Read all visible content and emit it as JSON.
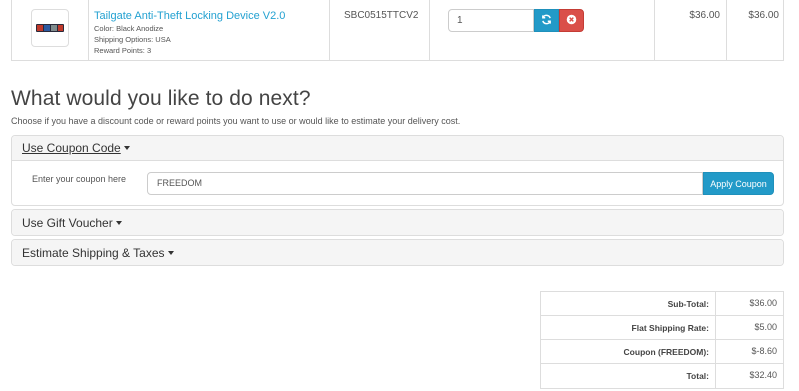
{
  "cart": {
    "product_name": "Tailgate Anti-Theft Locking Device V2.0",
    "options": [
      "Color: Black Anodize",
      "Shipping Options: USA",
      "Reward Points: 3"
    ],
    "model": "SBC0515TTCV2",
    "quantity": "1",
    "unit_price": "$36.00",
    "total": "$36.00",
    "icons": {
      "update": "refresh-icon",
      "remove": "times-circle-icon"
    },
    "colors": {
      "update": "#229ac8",
      "remove": "#da4f49",
      "link": "#23a1d1"
    }
  },
  "next_steps": {
    "title": "What would you like to do next?",
    "subtitle": "Choose if you have a discount code or reward points you want to use or would like to estimate your delivery cost."
  },
  "coupon": {
    "title": "Use Coupon Code",
    "label": "Enter your coupon here",
    "value": "FREEDOM",
    "button": "Apply Coupon"
  },
  "voucher": {
    "title": "Use Gift Voucher"
  },
  "shipping": {
    "title": "Estimate Shipping & Taxes"
  },
  "totals": [
    {
      "label": "Sub-Total:",
      "value": "$36.00"
    },
    {
      "label": "Flat Shipping Rate:",
      "value": "$5.00"
    },
    {
      "label": "Coupon (FREEDOM):",
      "value": "$-8.60"
    },
    {
      "label": "Total:",
      "value": "$32.40"
    }
  ]
}
